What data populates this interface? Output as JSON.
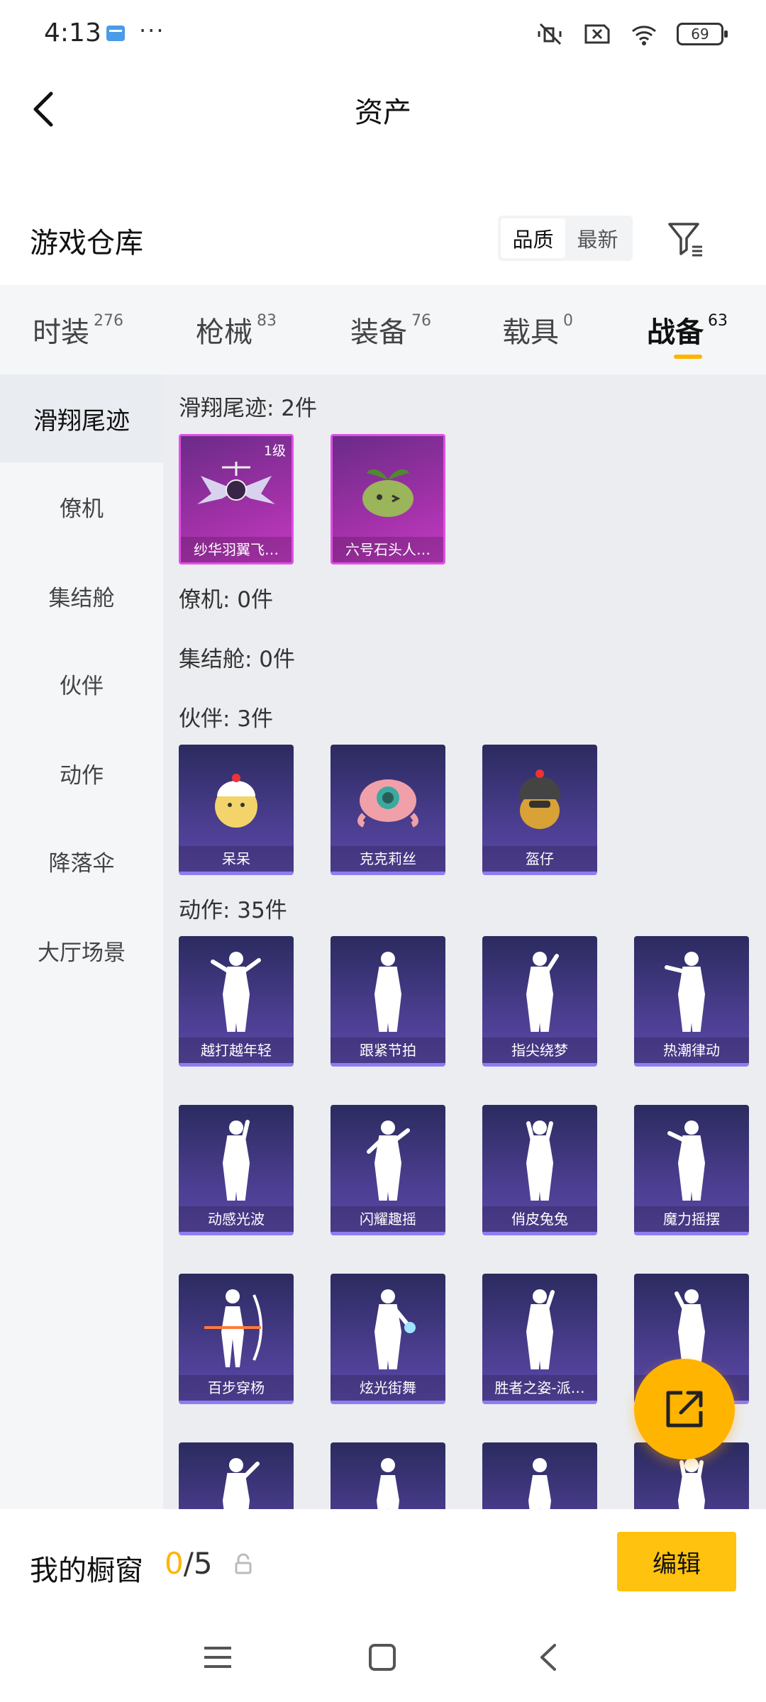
{
  "status_bar": {
    "time": "4:13",
    "more": "···",
    "battery": "69"
  },
  "header": {
    "title": "资产"
  },
  "warehouse": {
    "title": "游戏仓库",
    "sort_options": [
      "品质",
      "最新"
    ],
    "active_sort": "品质"
  },
  "tabs": [
    {
      "label": "时装",
      "count": "276"
    },
    {
      "label": "枪械",
      "count": "83"
    },
    {
      "label": "装备",
      "count": "76"
    },
    {
      "label": "载具",
      "count": "0"
    },
    {
      "label": "战备",
      "count": "63"
    }
  ],
  "active_tab": "战备",
  "left_nav": [
    "滑翔尾迹",
    "僚机",
    "集结舱",
    "伙伴",
    "动作",
    "降落伞",
    "大厅场景"
  ],
  "groups": {
    "trail": {
      "title": "滑翔尾迹: 2件",
      "items": [
        {
          "name": "纱华羽翼飞…",
          "level": "1级"
        },
        {
          "name": "六号石头人…"
        }
      ]
    },
    "wingman": {
      "title": "僚机: 0件"
    },
    "assembly": {
      "title": "集结舱: 0件"
    },
    "partner": {
      "title": "伙伴: 3件",
      "items": [
        {
          "name": "呆呆"
        },
        {
          "name": "克克莉丝"
        },
        {
          "name": "盔仔"
        }
      ]
    },
    "emote": {
      "title": "动作: 35件",
      "items": [
        {
          "name": "越打越年轻"
        },
        {
          "name": "跟紧节拍"
        },
        {
          "name": "指尖绕梦"
        },
        {
          "name": "热潮律动"
        },
        {
          "name": "动感光波"
        },
        {
          "name": "闪耀趣摇"
        },
        {
          "name": "俏皮兔兔"
        },
        {
          "name": "魔力摇摆"
        },
        {
          "name": "百步穿杨"
        },
        {
          "name": "炫光街舞"
        },
        {
          "name": "胜者之姿-派…"
        },
        {
          "name": ""
        },
        {
          "name": ""
        },
        {
          "name": ""
        },
        {
          "name": ""
        },
        {
          "name": ""
        }
      ]
    }
  },
  "showcase": {
    "title": "我的橱窗",
    "current": "0",
    "total": "/5",
    "edit_label": "编辑"
  },
  "colors": {
    "accent": "#ffb400",
    "edit_button": "#ffc20e",
    "trail_card": "#b233b6",
    "partner_card": "#4a3d8e"
  }
}
